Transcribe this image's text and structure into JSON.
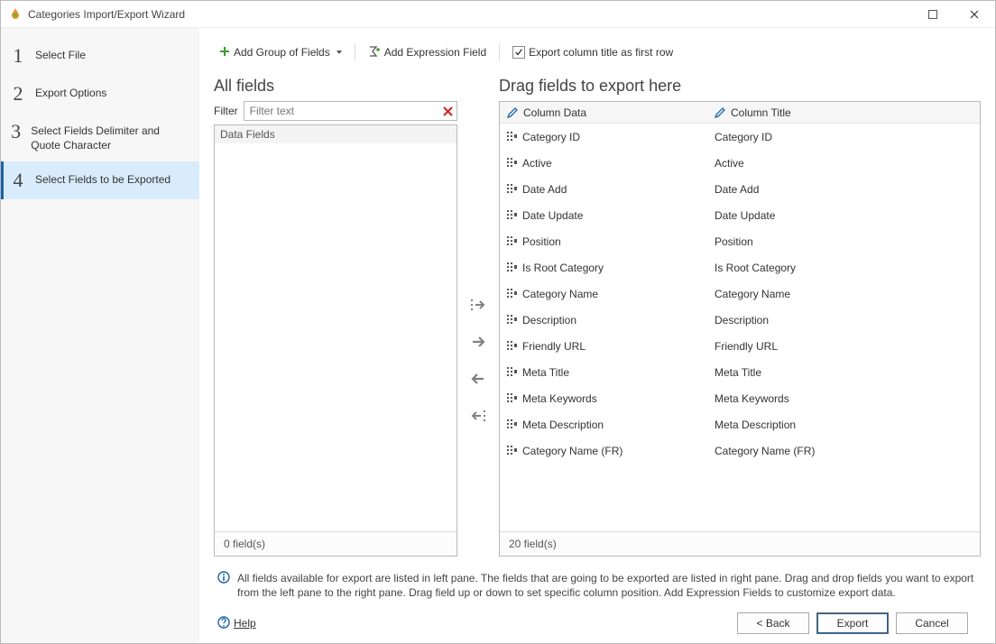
{
  "title": "Categories Import/Export Wizard",
  "sidebar": {
    "steps": [
      {
        "label": "Select File"
      },
      {
        "label": "Export Options"
      },
      {
        "label": "Select Fields Delimiter and Quote Character"
      },
      {
        "label": "Select Fields to be Exported"
      }
    ],
    "active_index": 3
  },
  "toolbar": {
    "add_group": "Add Group of Fields",
    "add_expr": "Add Expression Field",
    "export_title_checkbox": "Export column title as first row",
    "export_title_checked": true
  },
  "left_pane": {
    "title": "All fields",
    "filter_label": "Filter",
    "filter_placeholder": "Filter text",
    "group_header": "Data Fields",
    "footer": "0 field(s)"
  },
  "right_pane": {
    "title": "Drag fields to export here",
    "col1": "Column Data",
    "col2": "Column Title",
    "rows": [
      {
        "data": "Category ID",
        "title": "Category ID"
      },
      {
        "data": "Active",
        "title": "Active"
      },
      {
        "data": "Date Add",
        "title": "Date Add"
      },
      {
        "data": "Date Update",
        "title": "Date Update"
      },
      {
        "data": "Position",
        "title": "Position"
      },
      {
        "data": "Is Root Category",
        "title": "Is Root Category"
      },
      {
        "data": "Category Name",
        "title": "Category Name"
      },
      {
        "data": "Description",
        "title": "Description"
      },
      {
        "data": "Friendly URL",
        "title": "Friendly URL"
      },
      {
        "data": "Meta Title",
        "title": "Meta Title"
      },
      {
        "data": "Meta Keywords",
        "title": "Meta Keywords"
      },
      {
        "data": "Meta Description",
        "title": "Meta Description"
      },
      {
        "data": "Category Name (FR)",
        "title": "Category Name (FR)"
      }
    ],
    "footer": "20 field(s)"
  },
  "info_text": "All fields available for export are listed in left pane. The fields that are going to be exported are listed in right pane. Drag and drop fields you want to export from the left pane to the right pane. Drag field up or down to set specific column position. Add Expression Fields to customize export data.",
  "footer": {
    "help": "Help",
    "back": "< Back",
    "export": "Export",
    "cancel": "Cancel"
  }
}
